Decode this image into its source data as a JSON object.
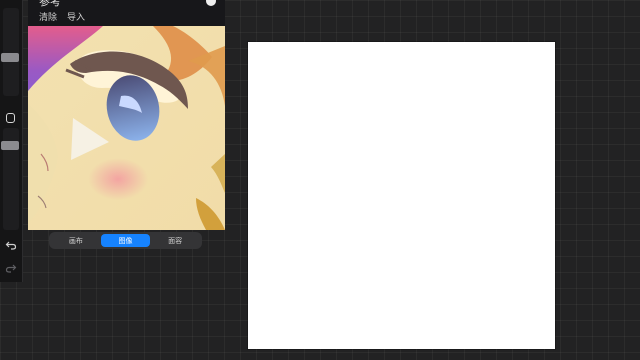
{
  "reference_panel": {
    "title": "参考",
    "actions": [
      "清除",
      "导入"
    ]
  },
  "view_modes": {
    "options": [
      "画布",
      "图像",
      "面容"
    ],
    "selected": "图像"
  },
  "colors": {
    "accent": "#1683ff",
    "background": "#222223",
    "panel": "#17171a",
    "canvas": "#ffffff"
  },
  "icons": {
    "reference_close": "close-dot-icon",
    "undo": "undo-icon",
    "redo": "redo-icon",
    "modify": "square-icon"
  }
}
